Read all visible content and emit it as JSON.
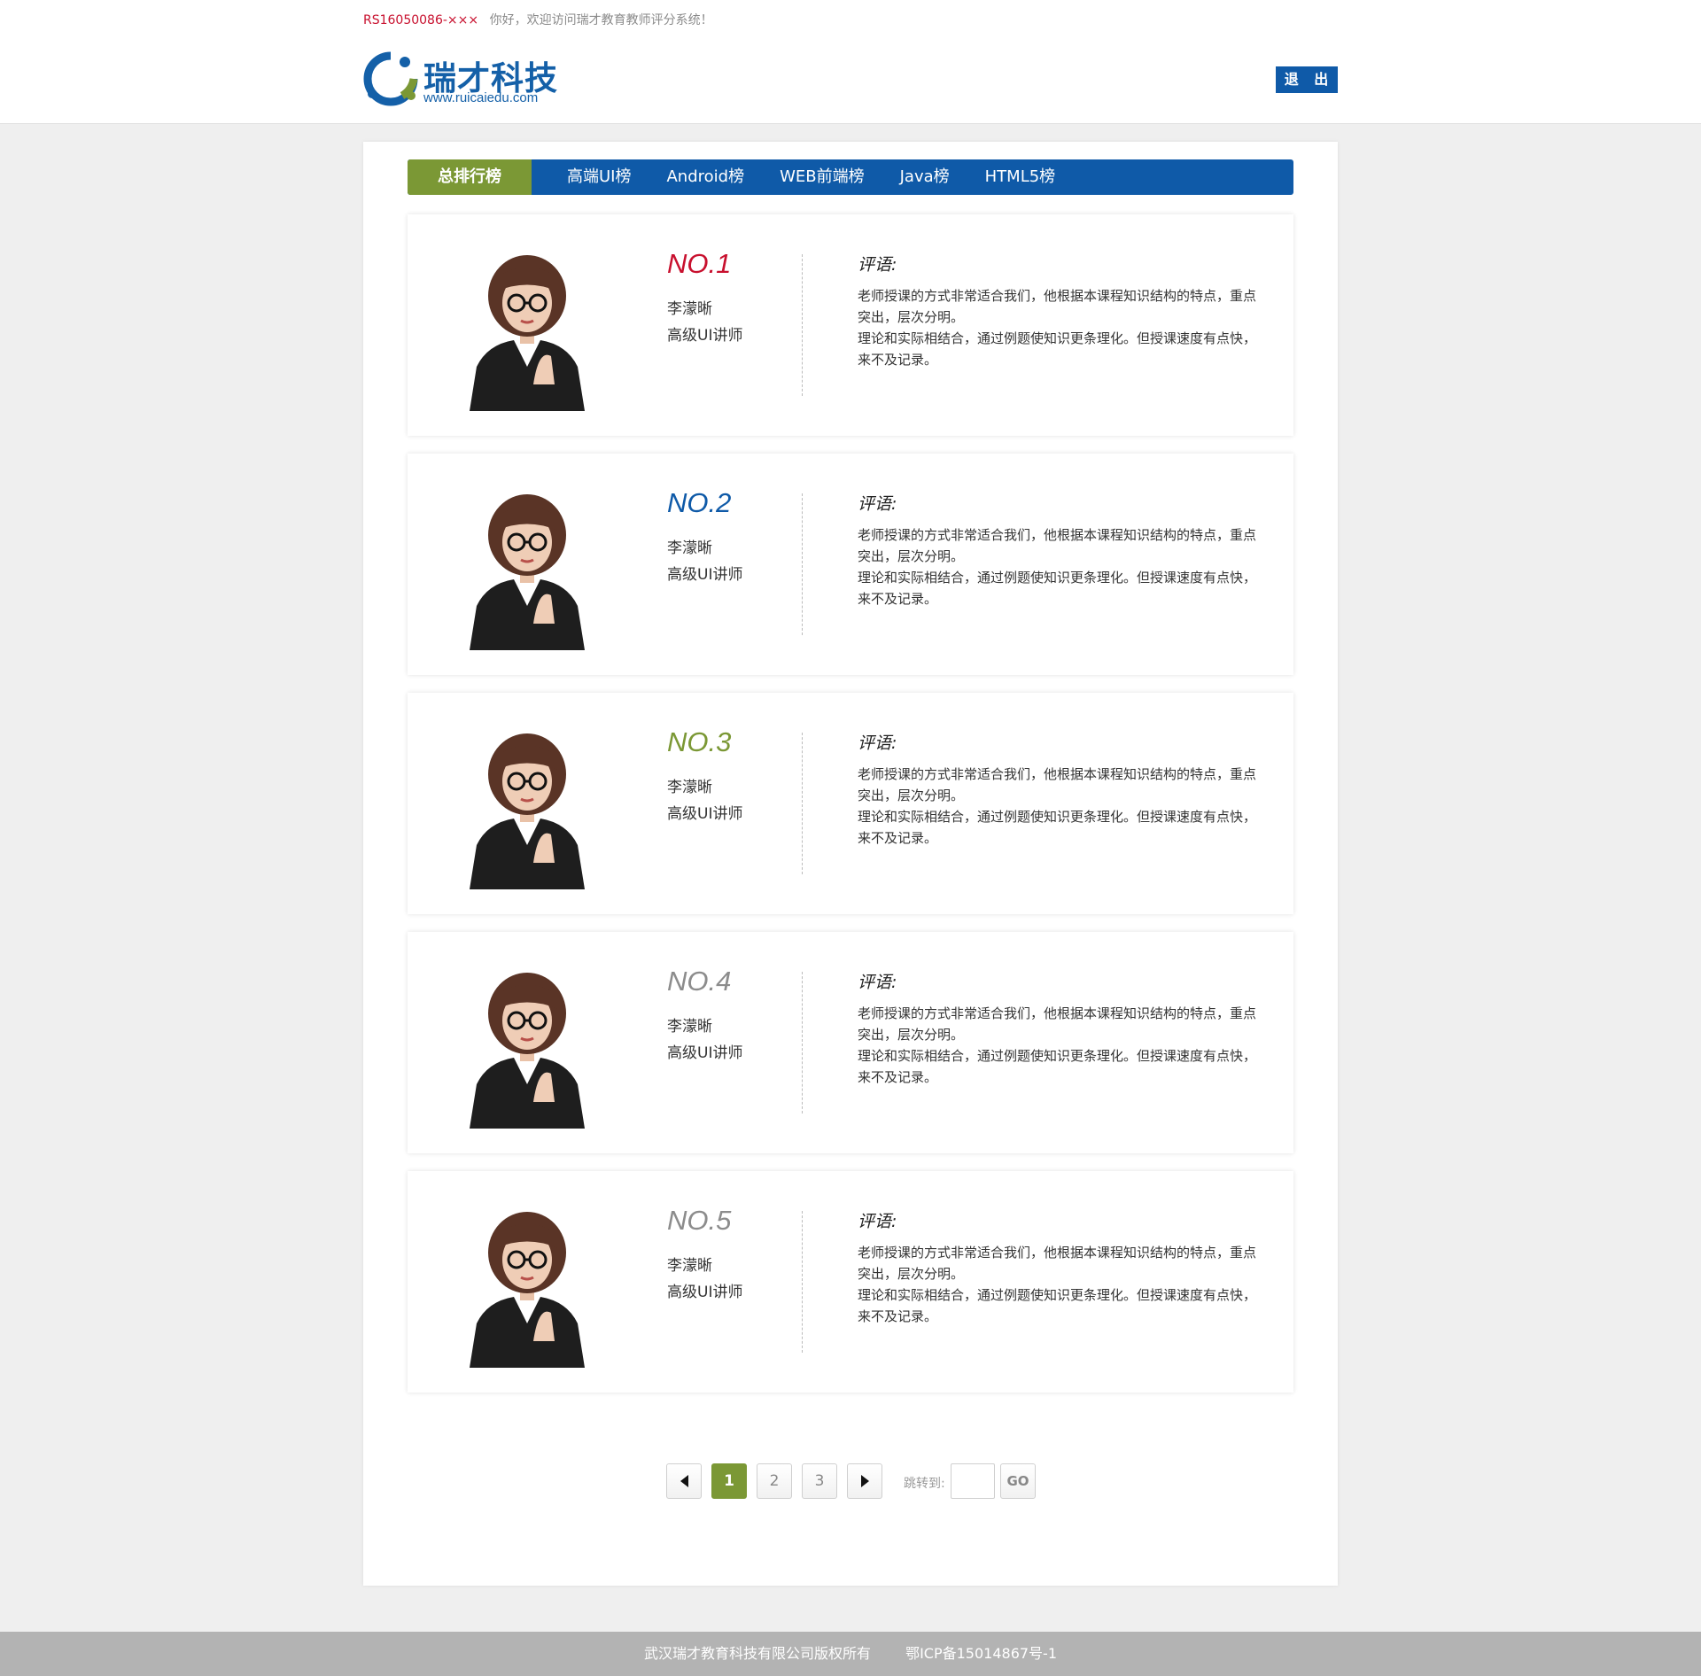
{
  "topbar": {
    "user_id": "RS16050086-×××",
    "welcome": "你好，欢迎访问瑞才教育教师评分系统！"
  },
  "logo": {
    "title": "瑞才科技",
    "url": "www.ruicaiedu.com"
  },
  "logout_label": "退 出",
  "tabs": [
    {
      "label": "总排行榜",
      "active": true
    },
    {
      "label": "高端UI榜"
    },
    {
      "label": "Android榜"
    },
    {
      "label": "WEB前端榜"
    },
    {
      "label": "Java榜"
    },
    {
      "label": "HTML5榜"
    }
  ],
  "cards": [
    {
      "rank": "NO.1",
      "rank_color": "#c8102e",
      "name": "李濛晰",
      "title": "高级UI讲师",
      "review_label": "评语:",
      "review_text": "老师授课的方式非常适合我们，他根据本课程知识结构的特点，重点突出，层次分明。\n理论和实际相结合，通过例题使知识更条理化。但授课速度有点快，来不及记录。"
    },
    {
      "rank": "NO.2",
      "rank_color": "#0f5aa8",
      "name": "李濛晰",
      "title": "高级UI讲师",
      "review_label": "评语:",
      "review_text": "老师授课的方式非常适合我们，他根据本课程知识结构的特点，重点突出，层次分明。\n理论和实际相结合，通过例题使知识更条理化。但授课速度有点快，来不及记录。"
    },
    {
      "rank": "NO.3",
      "rank_color": "#7b9835",
      "name": "李濛晰",
      "title": "高级UI讲师",
      "review_label": "评语:",
      "review_text": "老师授课的方式非常适合我们，他根据本课程知识结构的特点，重点突出，层次分明。\n理论和实际相结合，通过例题使知识更条理化。但授课速度有点快，来不及记录。"
    },
    {
      "rank": "NO.4",
      "rank_color": "#8c8c8c",
      "name": "李濛晰",
      "title": "高级UI讲师",
      "review_label": "评语:",
      "review_text": "老师授课的方式非常适合我们，他根据本课程知识结构的特点，重点突出，层次分明。\n理论和实际相结合，通过例题使知识更条理化。但授课速度有点快，来不及记录。"
    },
    {
      "rank": "NO.5",
      "rank_color": "#8c8c8c",
      "name": "李濛晰",
      "title": "高级UI讲师",
      "review_label": "评语:",
      "review_text": "老师授课的方式非常适合我们，他根据本课程知识结构的特点，重点突出，层次分明。\n理论和实际相结合，通过例题使知识更条理化。但授课速度有点快，来不及记录。"
    }
  ],
  "pager": {
    "pages": [
      "1",
      "2",
      "3"
    ],
    "current": "1",
    "jump_label": "跳转到:",
    "jump_value": "",
    "go_label": "GO",
    "prev_icon": "triangle-left-icon",
    "next_icon": "triangle-right-icon"
  },
  "footer": {
    "copyright": "武汉瑞才教育科技有限公司版权所有",
    "icp": "鄂ICP备15014867号-1"
  }
}
